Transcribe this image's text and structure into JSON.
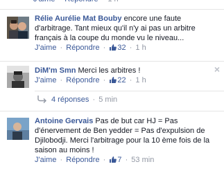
{
  "labels": {
    "like": "J'aime",
    "reply": "Répondre",
    "sep": "·"
  },
  "top_actions": {
    "time": "1 h"
  },
  "comments": [
    {
      "author": "Rélie Aurélie Mat Bouby",
      "text": "encore une faute d'arbitrage. Tant mieux qu'il n'y ai pas un arbitre français à la coupe du monde vu le niveau...",
      "likes": "32",
      "time": "1 h"
    },
    {
      "author": "DiM'm Smn",
      "text": "Merci les arbitres !",
      "likes": "22",
      "time": "1 h",
      "close": "×"
    },
    {
      "author": "Antoine Gervais",
      "text": "Pas de but car HJ = Pas d'énervement de Ben yedder = Pas d'expulsion de Djilobodji. Merci l'arbitrage pour la 10 ème fois de la saison au moins !",
      "likes": "7",
      "time": "53 min"
    }
  ],
  "replies": {
    "label": "4 réponses",
    "time": "5 min"
  },
  "icons": {
    "like": "thumbs-up-icon",
    "reply": "reply-arrow-icon",
    "close": "close-icon"
  },
  "colors": {
    "link": "#3b5998",
    "muted": "#9197a3",
    "divider": "#e5e5e5"
  }
}
